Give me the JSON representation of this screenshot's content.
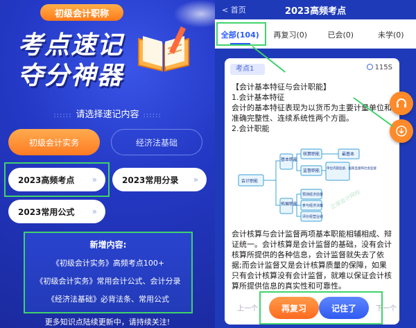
{
  "left": {
    "badge": "初级会计职称",
    "headline_line1": "考点速记",
    "headline_line2": "夺分神器",
    "choose_label": "请选择速记内容",
    "categories": [
      "初级会计实务",
      "经济法基础"
    ],
    "items": [
      "2023高频考点",
      "2023常用分录",
      "2023常用公式"
    ],
    "new_content": {
      "title": "新增内容:",
      "lines": [
        "《初级会计实务》高频考点100+",
        "《初级会计实务》常用会计公式、会计分录",
        "《经济法基础》必背法条、常用公式"
      ]
    },
    "footer": "更多知识点陆续更新中，请持续关注!"
  },
  "right": {
    "back": "< 首页",
    "title": "2023高频考点",
    "tabs": [
      "全部(104)",
      "再复习(0)",
      "已会(0)",
      "未学(0)"
    ],
    "card": {
      "tag": "考点1",
      "timer": "115S",
      "heading": "【会计基本特征与会计职能】",
      "sub1": "1.会计基本特征",
      "sub1_text": "会计的基本特征表现为以货币为主要计量单位和准确完整性、连续系统性两个方面。",
      "sub2": "2.会计职能",
      "diagram": {
        "root": "会计职能",
        "basic": "基本职能",
        "expand": "拓展职能",
        "accounting": "核算职能",
        "supervision": "监督职能",
        "most_basic": "最基本",
        "sup_detail": "单位内部监督、国家监督和社会监督",
        "predict": "预测经济前景",
        "decision": "参与经济决策",
        "evaluate": "评价经营业绩",
        "watermark": "正保会计网校"
      },
      "para": "会计核算与会计监督两项基本职能相辅相成、辩证统一。会计核算是会计监督的基础，没有会计核算所提供的各种信息，会计监督就失去了依据;而会计监督又是会计核算质量的保障，如果只有会计核算没有会计监督，就难以保证会计核算所提供信息的真实性和可靠性。"
    },
    "prev": "上一个",
    "next": "下一个",
    "review_btn": "再复习",
    "mastered_btn": "记住了",
    "fab_icons": [
      "headset-icon",
      "download-icon"
    ]
  },
  "colors": {
    "accent_orange": "#ff7b22",
    "accent_blue": "#2f5af0",
    "highlight_green": "#3fd36a",
    "bg_blue": "#1f3ab8"
  }
}
